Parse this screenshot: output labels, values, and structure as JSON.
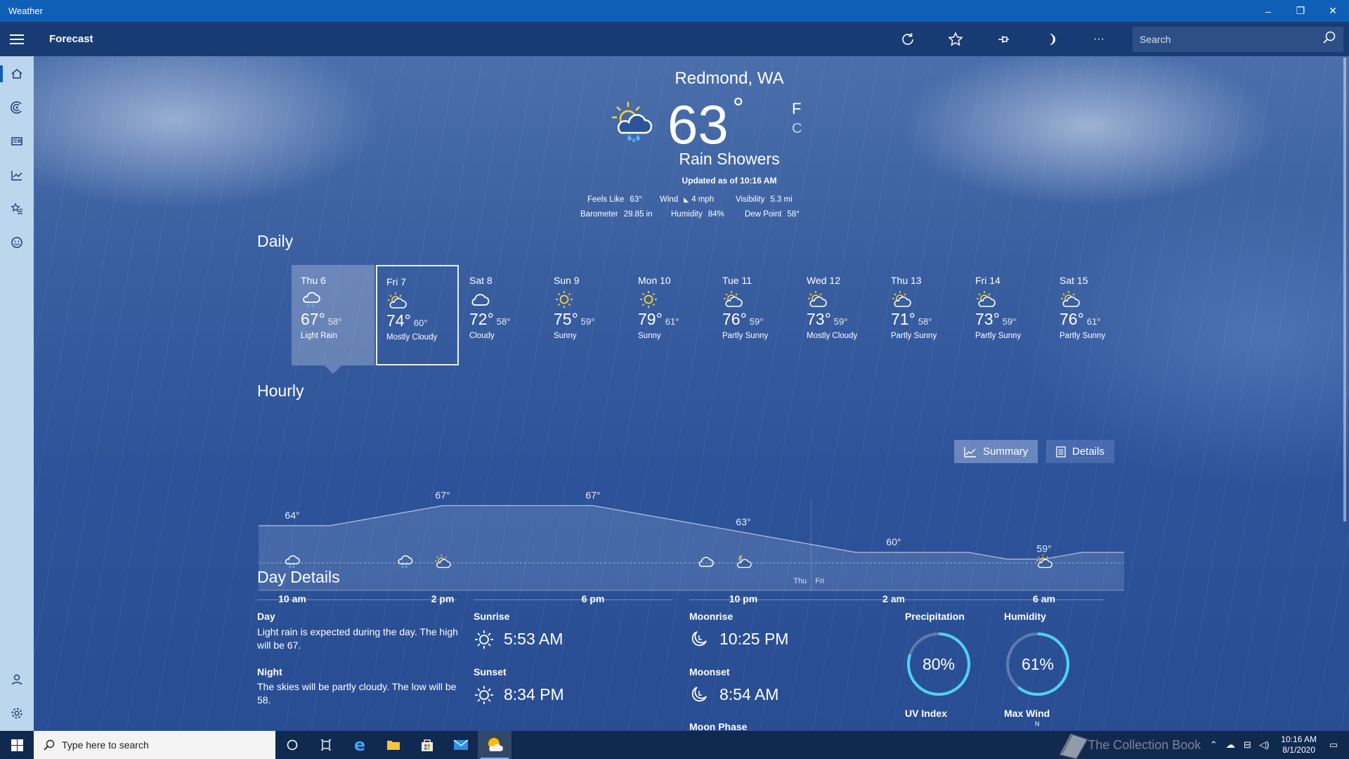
{
  "window": {
    "title": "Weather",
    "minimize": "–",
    "restore": "❐",
    "close": "✕"
  },
  "appbar": {
    "section_title": "Forecast",
    "search_placeholder": "Search",
    "more": "···"
  },
  "current": {
    "location": "Redmond, WA",
    "temp": "63",
    "degree": "°",
    "unit_f": "F",
    "unit_c": "C",
    "condition": "Rain Showers",
    "updated": "Updated as of 10:16 AM",
    "stats": {
      "feels_like_label": "Feels Like",
      "feels_like": "63°",
      "wind_label": "Wind",
      "wind": "4 mph",
      "visibility_label": "Visibility",
      "visibility": "5.3 mi",
      "barometer_label": "Barometer",
      "barometer": "29.85 in",
      "humidity_label": "Humidity",
      "humidity": "84%",
      "dew_point_label": "Dew Point",
      "dew_point": "58°"
    }
  },
  "daily": {
    "heading": "Daily",
    "days": [
      {
        "name": "Thu 6",
        "hi": "67°",
        "lo": "58°",
        "cond": "Light Rain",
        "icon": "rain-cloud-icon"
      },
      {
        "name": "Fri 7",
        "hi": "74°",
        "lo": "60°",
        "cond": "Mostly Cloudy",
        "icon": "partly-sunny-icon"
      },
      {
        "name": "Sat 8",
        "hi": "72°",
        "lo": "58°",
        "cond": "Cloudy",
        "icon": "cloud-icon"
      },
      {
        "name": "Sun 9",
        "hi": "75°",
        "lo": "59°",
        "cond": "Sunny",
        "icon": "sun-icon"
      },
      {
        "name": "Mon 10",
        "hi": "79°",
        "lo": "61°",
        "cond": "Sunny",
        "icon": "sun-icon"
      },
      {
        "name": "Tue 11",
        "hi": "76°",
        "lo": "59°",
        "cond": "Partly Sunny",
        "icon": "partly-sunny-icon"
      },
      {
        "name": "Wed 12",
        "hi": "73°",
        "lo": "59°",
        "cond": "Mostly Cloudy",
        "icon": "partly-sunny-icon"
      },
      {
        "name": "Thu 13",
        "hi": "71°",
        "lo": "58°",
        "cond": "Partly Sunny",
        "icon": "partly-sunny-icon"
      },
      {
        "name": "Fri 14",
        "hi": "73°",
        "lo": "59°",
        "cond": "Partly Sunny",
        "icon": "partly-sunny-icon"
      },
      {
        "name": "Sat 15",
        "hi": "76°",
        "lo": "61°",
        "cond": "Partly Sunny",
        "icon": "partly-sunny-icon"
      }
    ]
  },
  "hourly": {
    "heading": "Hourly",
    "summary_label": "Summary",
    "details_label": "Details",
    "time_labels": [
      "10 am",
      "2 pm",
      "6 pm",
      "10 pm",
      "2 am",
      "6 am"
    ],
    "day_markers": [
      "Thu",
      "Fri"
    ],
    "temp_labels": [
      "64°",
      "67°",
      "67°",
      "63°",
      "60°",
      "59°"
    ]
  },
  "chart_data": {
    "type": "area",
    "x": [
      "10 am",
      "11 am",
      "12 pm",
      "1 pm",
      "2 pm",
      "3 pm",
      "4 pm",
      "5 pm",
      "6 pm",
      "7 pm",
      "8 pm",
      "9 pm",
      "10 pm",
      "11 pm",
      "12 am",
      "1 am",
      "2 am",
      "3 am",
      "4 am",
      "5 am",
      "6 am",
      "7 am",
      "8 am"
    ],
    "series": [
      {
        "values": [
          64,
          64,
          65,
          66,
          67,
          67,
          67,
          67,
          67,
          66,
          65,
          64,
          63,
          62,
          61,
          60,
          60,
          60,
          60,
          59,
          59,
          60,
          60
        ]
      }
    ],
    "icons": [
      {
        "x": "10 am",
        "icon": "rain-cloud-icon"
      },
      {
        "x": "1 pm",
        "icon": "rain-cloud-icon"
      },
      {
        "x": "2 pm",
        "icon": "partly-sunny-icon"
      },
      {
        "x": "9 pm",
        "icon": "cloud-icon"
      },
      {
        "x": "10 pm",
        "icon": "partly-cloudy-night-icon"
      },
      {
        "x": "6 am",
        "icon": "partly-sunny-icon"
      }
    ],
    "labeled_points": [
      "10 am",
      "2 pm",
      "6 pm",
      "10 pm",
      "2 am",
      "6 am"
    ]
  },
  "day_details": {
    "heading": "Day Details",
    "day_label": "Day",
    "day_text": "Light rain is expected during the day. The high will be 67.",
    "night_label": "Night",
    "night_text": "The skies will be partly cloudy. The low will be 58.",
    "sunrise_label": "Sunrise",
    "sunrise": "5:53 AM",
    "sunset_label": "Sunset",
    "sunset": "8:34 PM",
    "moonrise_label": "Moonrise",
    "moonrise": "10:25 PM",
    "moonset_label": "Moonset",
    "moonset": "8:54 AM",
    "moon_phase_label": "Moon Phase",
    "precip_label": "Precipitation",
    "precip": "80%",
    "precip_value": 0.8,
    "humidity_label": "Humidity",
    "humidity": "61%",
    "humidity_value": 0.61,
    "uv_label": "UV Index",
    "max_wind_label": "Max Wind",
    "max_wind_dir": "N"
  },
  "taskbar": {
    "search_placeholder": "Type here to search",
    "watermark": "The Collection Book",
    "time": "10:16 AM",
    "date": "8/1/2020"
  },
  "colors": {
    "titlebar": "#0f5fb7",
    "appbar": "#193b73",
    "sidebar": "#bcd6ee",
    "ring": "#4fd2f0",
    "taskbar": "#10294f"
  }
}
